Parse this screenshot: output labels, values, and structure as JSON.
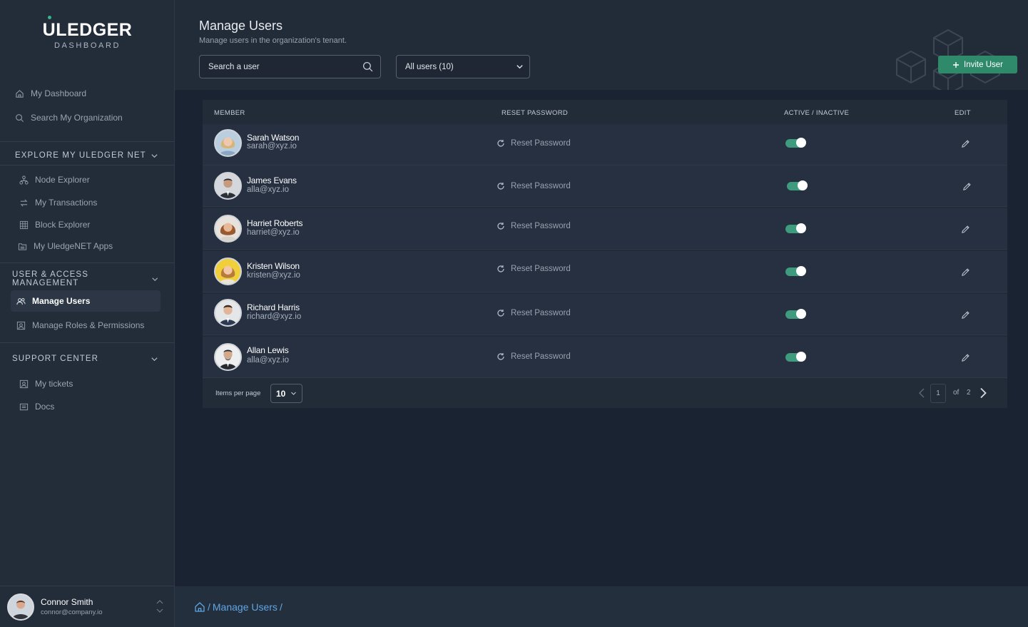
{
  "app": {
    "logo_text": "LEDGER",
    "logo_u": "U",
    "logo_sub": "DASHBOARD",
    "accent_color": "#2f8a6c"
  },
  "sidebar": {
    "top_items": [
      {
        "label": "My Dashboard",
        "icon": "home-icon"
      },
      {
        "label": "Search My Organization",
        "icon": "search-icon"
      }
    ],
    "sections": [
      {
        "title": "EXPLORE MY ULEDGER NET",
        "items": [
          {
            "label": "Node Explorer",
            "icon": "node-icon"
          },
          {
            "label": "My Transactions",
            "icon": "transfer-icon"
          },
          {
            "label": "Block Explorer",
            "icon": "block-icon"
          },
          {
            "label": "My UledgeNET Apps",
            "icon": "apps-icon"
          }
        ]
      },
      {
        "title": "USER & ACCESS MANAGEMENT",
        "items": [
          {
            "label": "Manage Users",
            "icon": "users-icon",
            "active": true
          },
          {
            "label": "Manage Roles & Permissions",
            "icon": "id-card-icon"
          }
        ]
      },
      {
        "title": "SUPPORT CENTER",
        "items": [
          {
            "label": "My tickets",
            "icon": "ticket-icon"
          },
          {
            "label": "Docs",
            "icon": "docs-icon"
          }
        ]
      }
    ],
    "current_user": {
      "name": "Connor Smith",
      "email": "connor@company.io"
    }
  },
  "header": {
    "title": "Manage Users",
    "subtitle": "Manage users in the organization's tenant.",
    "search_placeholder": "Search a user",
    "filter_value": "All users (10)",
    "invite_label": "Invite User"
  },
  "table": {
    "columns": [
      "MEMBER",
      "RESET PASSWORD",
      "ACTIVE / INACTIVE",
      "EDIT"
    ],
    "reset_label": "Reset Password",
    "rows": [
      {
        "name": "Sarah Watson",
        "email": "sarah@xyz.io",
        "active": true
      },
      {
        "name": "James Evans",
        "email": "alla@xyz.io",
        "active": true
      },
      {
        "name": "Harriet Roberts",
        "email": "harriet@xyz.io",
        "active": true
      },
      {
        "name": "Kristen Wilson",
        "email": "kristen@xyz.io",
        "active": true
      },
      {
        "name": "Richard Harris",
        "email": "richard@xyz.io",
        "active": true
      },
      {
        "name": "Allan Lewis",
        "email": "alla@xyz.io",
        "active": true
      }
    ],
    "pagination": {
      "items_per_page_label": "Items per page",
      "items_per_page": "10",
      "current_page": "1",
      "of_label": "of",
      "total_pages": "2"
    }
  },
  "breadcrumb": {
    "prefix": "/",
    "current": "Manage Users",
    "suffix": "/"
  }
}
